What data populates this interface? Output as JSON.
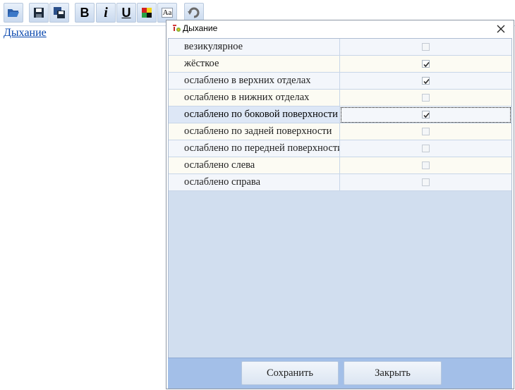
{
  "toolbar": {
    "buttons": [
      {
        "name": "open-folder-icon"
      },
      {
        "name": "save-icon"
      },
      {
        "name": "save-all-icon"
      },
      {
        "name": "bold-icon",
        "label": "B"
      },
      {
        "name": "italic-icon",
        "label": "i"
      },
      {
        "name": "underline-icon",
        "label": "U"
      },
      {
        "name": "color-icon"
      },
      {
        "name": "font-icon",
        "label": "Aa"
      },
      {
        "name": "undo-icon"
      }
    ]
  },
  "document": {
    "link_text": "Дыхание"
  },
  "dialog": {
    "title": "Дыхание",
    "rows": [
      {
        "label": "везикулярное",
        "checked": false
      },
      {
        "label": "жёсткое",
        "checked": true
      },
      {
        "label": "ослаблено в верхних отделах",
        "checked": true
      },
      {
        "label": "ослаблено в нижних отделах",
        "checked": false
      },
      {
        "label": "ослаблено по боковой поверхности",
        "checked": true,
        "selected": true
      },
      {
        "label": "ослаблено по задней поверхности",
        "checked": false
      },
      {
        "label": "ослаблено по передней поверхности",
        "checked": false
      },
      {
        "label": "ослаблено слева",
        "checked": false
      },
      {
        "label": "ослаблено справа",
        "checked": false
      }
    ],
    "save_label": "Сохранить",
    "close_label": "Закрыть"
  }
}
